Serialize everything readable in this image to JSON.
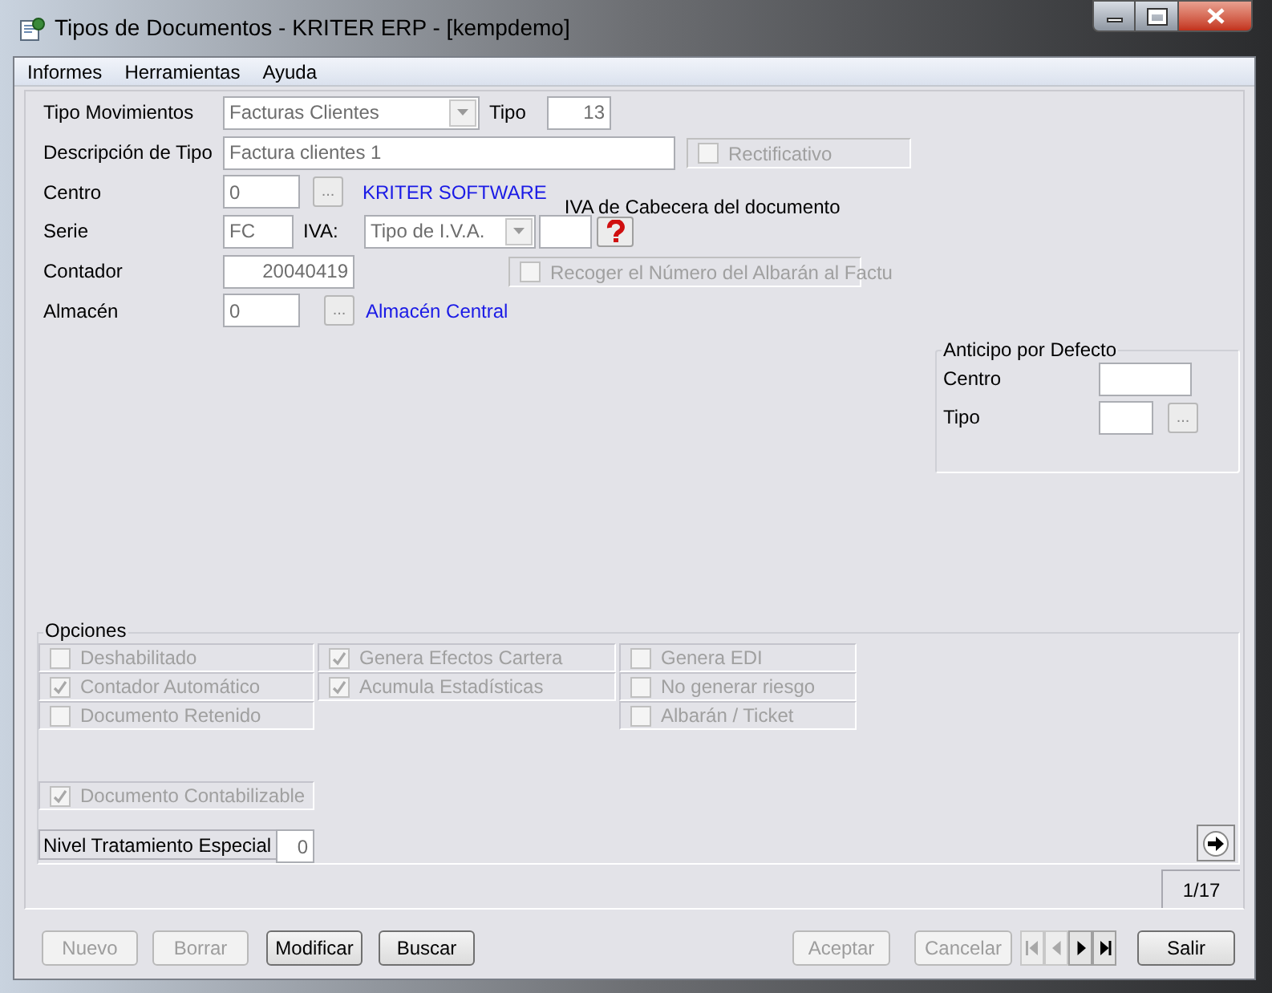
{
  "window": {
    "title": "Tipos de Documentos - KRITER ERP - [kempdemo]"
  },
  "menu": [
    "Informes",
    "Herramientas",
    "Ayuda"
  ],
  "form": {
    "tipo_movimientos": {
      "label": "Tipo Movimientos",
      "value": "Facturas Clientes",
      "disabled": true
    },
    "tipo": {
      "label": "Tipo",
      "value": "13"
    },
    "descripcion": {
      "label": "Descripción de Tipo",
      "value": "Factura clientes 1"
    },
    "rectificativo": {
      "label": "Rectificativo",
      "checked": false,
      "disabled": true
    },
    "centro": {
      "label": "Centro",
      "value": "0",
      "button": "...",
      "name": "KRITER SOFTWARE"
    },
    "iva_cabecera": {
      "label": "IVA de Cabecera del documento"
    },
    "serie": {
      "label": "Serie",
      "value": "FC"
    },
    "iva": {
      "label": "IVA:",
      "value": "Tipo de I.V.A.",
      "disabled": true
    },
    "contador": {
      "label": "Contador",
      "value": "20040419"
    },
    "recoger": {
      "label": "Recoger el Número del Albarán al Factu",
      "checked": false,
      "disabled": true
    },
    "almacen": {
      "label": "Almacén",
      "value": "0",
      "button": "...",
      "name": "Almacén Central"
    }
  },
  "anticipo": {
    "title": "Anticipo por Defecto",
    "centro_label": "Centro",
    "tipo_label": "Tipo",
    "button": "..."
  },
  "opciones": {
    "title": "Opciones",
    "columns": [
      [
        {
          "label": "Deshabilitado",
          "checked": false,
          "disabled": true
        },
        {
          "label": "Contador Automático",
          "checked": true,
          "disabled": true
        },
        {
          "label": "Documento Retenido",
          "checked": false,
          "disabled": true
        }
      ],
      [
        {
          "label": "Genera Efectos Cartera",
          "checked": true,
          "disabled": true
        },
        {
          "label": "Acumula Estadísticas",
          "checked": true,
          "disabled": true
        }
      ],
      [
        {
          "label": "Genera EDI",
          "checked": false,
          "disabled": true
        },
        {
          "label": "No generar riesgo",
          "checked": false,
          "disabled": true
        },
        {
          "label": "Albarán / Ticket",
          "checked": false,
          "disabled": true
        }
      ]
    ],
    "contabilizable": {
      "label": "Documento Contabilizable",
      "checked": true,
      "disabled": true
    },
    "nivel": {
      "label": "Nivel Tratamiento Especial",
      "value": "0"
    }
  },
  "record_counter": "1/17",
  "buttons_left": [
    {
      "label": "Nuevo",
      "disabled": true
    },
    {
      "label": "Borrar",
      "disabled": true
    },
    {
      "label": "Modificar",
      "disabled": false
    },
    {
      "label": "Buscar",
      "disabled": false
    }
  ],
  "buttons_right": [
    {
      "label": "Aceptar",
      "disabled": true
    },
    {
      "label": "Cancelar",
      "disabled": true
    }
  ],
  "nav_buttons": [
    {
      "kind": "first",
      "disabled": true
    },
    {
      "kind": "previous",
      "disabled": true
    },
    {
      "kind": "next",
      "disabled": false
    },
    {
      "kind": "last",
      "disabled": false
    }
  ],
  "exit_button": {
    "label": "Salir",
    "disabled": false
  }
}
